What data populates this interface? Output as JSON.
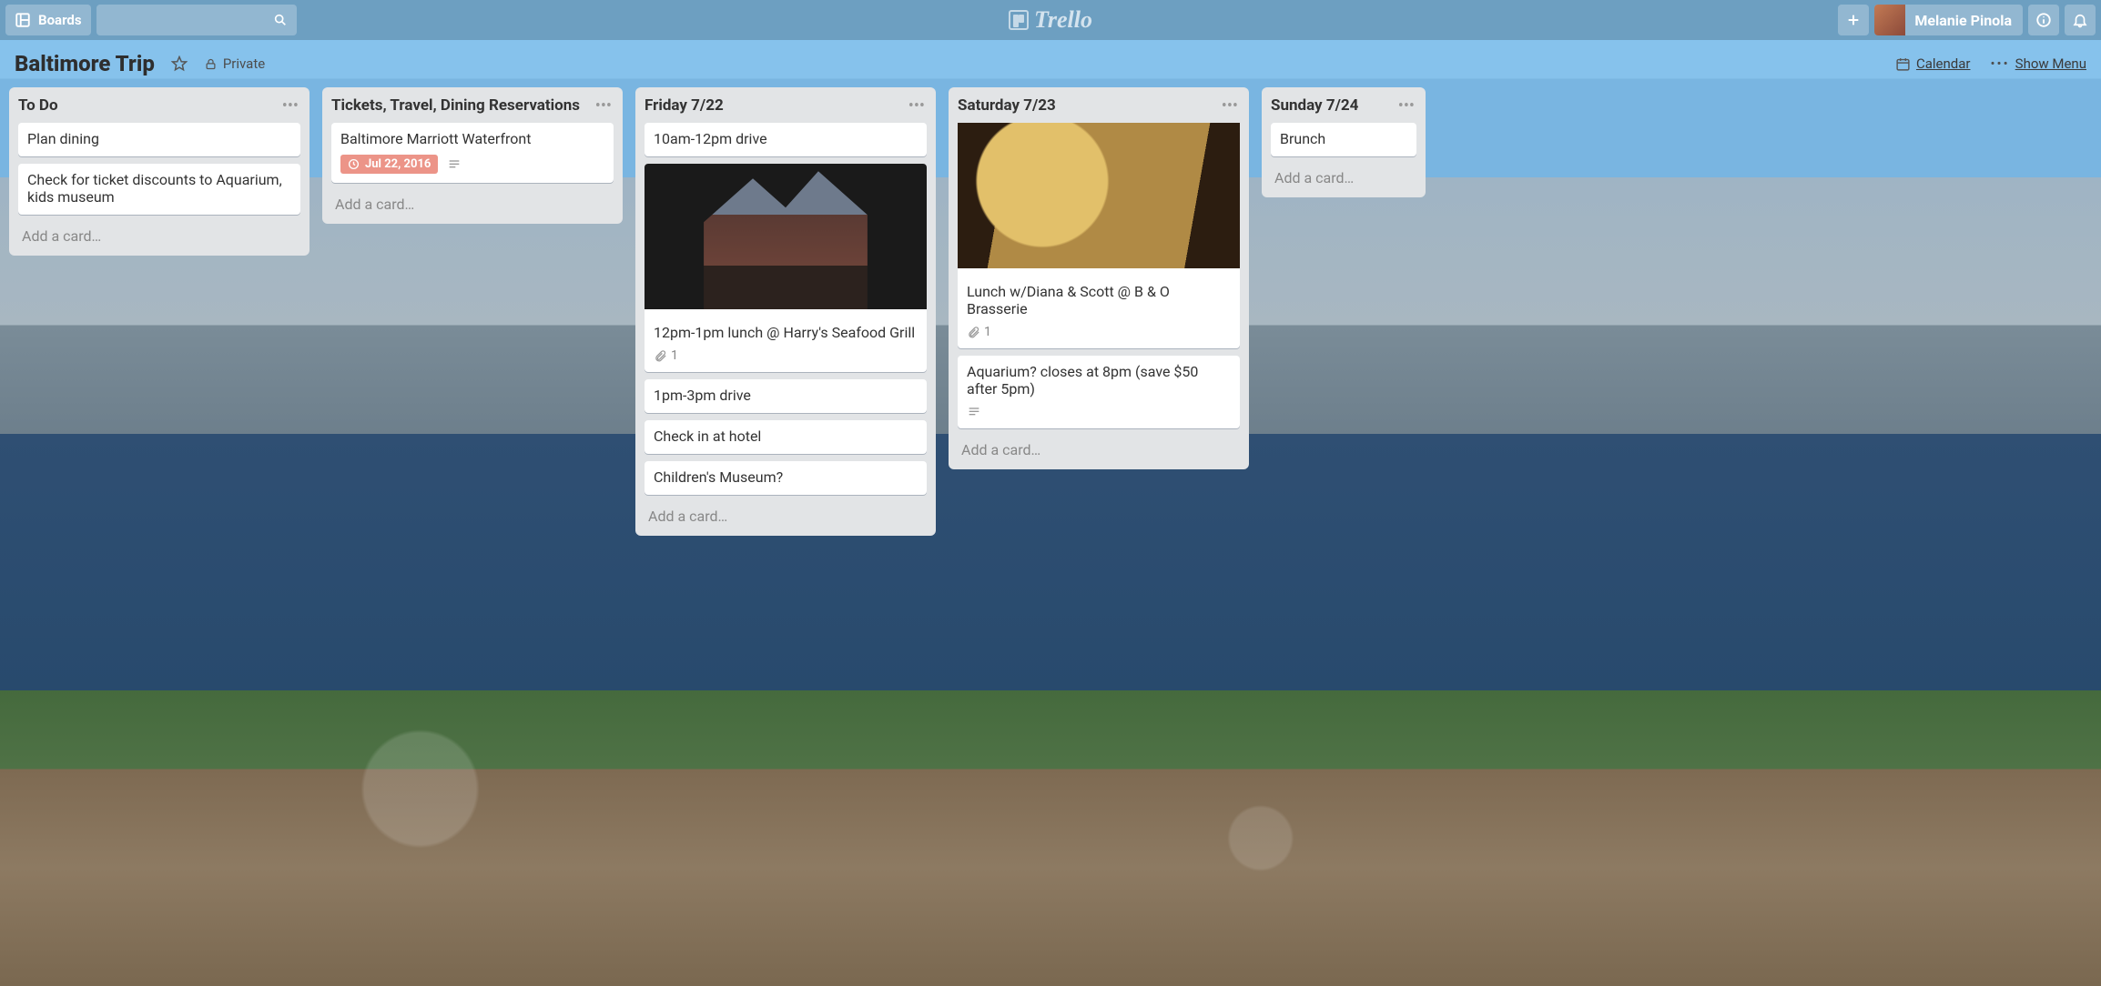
{
  "app": {
    "logo_text": "Trello",
    "boards_label": "Boards",
    "search_placeholder": ""
  },
  "user": {
    "display_name": "Melanie Pinola"
  },
  "board": {
    "title": "Baltimore Trip",
    "visibility": "Private",
    "calendar_label": "Calendar",
    "show_menu_label": "Show Menu"
  },
  "add_card_label": "Add a card…",
  "lists": [
    {
      "title": "To Do",
      "cards": [
        {
          "text": "Plan dining"
        },
        {
          "text": "Check for ticket discounts to Aquarium, kids museum"
        }
      ]
    },
    {
      "title": "Tickets, Travel, Dining Reservations",
      "cards": [
        {
          "text": "Baltimore Marriott Waterfront",
          "date_badge": "Jul 22, 2016",
          "has_description": true
        }
      ]
    },
    {
      "title": "Friday 7/22",
      "cards": [
        {
          "text": "10am-12pm drive"
        },
        {
          "text": "12pm-1pm lunch @ Harry's Seafood Grill",
          "cover": "building",
          "attachments": "1"
        },
        {
          "text": "1pm-3pm drive"
        },
        {
          "text": "Check in at hotel"
        },
        {
          "text": "Children's Museum?"
        }
      ]
    },
    {
      "title": "Saturday 7/23",
      "cards": [
        {
          "text": "Lunch w/Diana & Scott @ B & O Brasserie",
          "cover": "document",
          "attachments": "1"
        },
        {
          "text": "Aquarium? closes at 8pm (save $50 after 5pm)",
          "has_description": true
        }
      ]
    },
    {
      "title": "Sunday 7/24",
      "narrow": true,
      "cards": [
        {
          "text": "Brunch"
        }
      ]
    }
  ]
}
